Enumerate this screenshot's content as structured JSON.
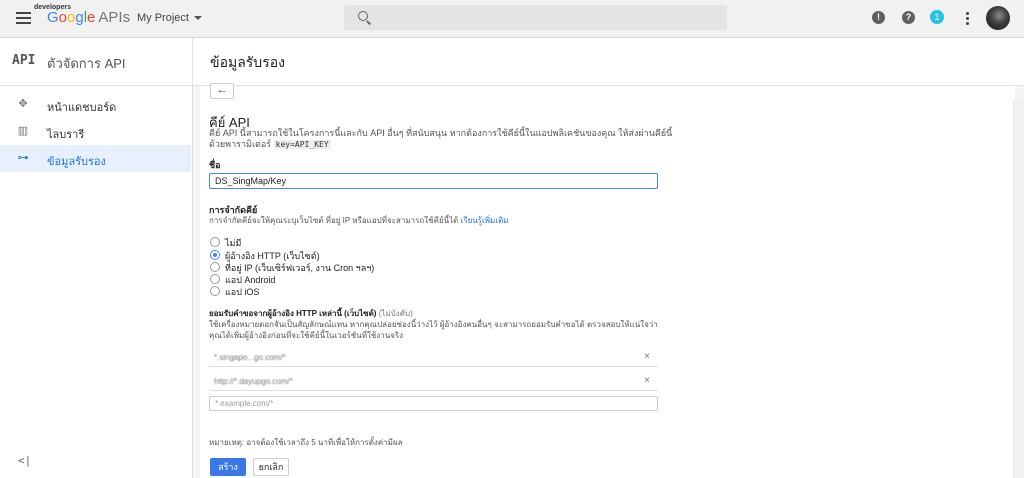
{
  "topbar": {
    "logo_small": "developers",
    "brand": {
      "g1": "G",
      "g2": "o",
      "g3": "o",
      "g4": "g",
      "g5": "l",
      "g6": "e",
      "apis": "APIs"
    },
    "project_name": "My Project",
    "notification_count": "1"
  },
  "sidebar": {
    "api_badge": "API",
    "title": "ตัวจัดการ API",
    "items": [
      {
        "label": "หน้าแดชบอร์ด",
        "icon": "dashboard-icon"
      },
      {
        "label": "ไลบรารี",
        "icon": "library-icon"
      },
      {
        "label": "ข้อมูลรับรอง",
        "icon": "key-icon"
      }
    ],
    "collapse": "<|"
  },
  "main": {
    "page_title": "ข้อมูลรับรอง",
    "back_label": "←",
    "section_title": "คีย์ API",
    "description_1": "คีย์ API นี้สามารถใช้ในโครงการนี้และกับ API อื่นๆ ที่สนับสนุน หากต้องการใช้คีย์นี้ในแอปพลิเคชันของคุณ ให้ส่งผ่านคีย์นี้",
    "description_2": "ด้วยพารามิเตอร์",
    "description_code": "key=API_KEY",
    "name_label": "ชื่อ",
    "name_value": "DS_SingMap/Key",
    "restriction_label": "การจำกัดคีย์",
    "restriction_desc": "การจำกัดคีย์จะให้คุณระบุเว็บไซต์ ที่อยู่ IP หรือแอปที่จะสามารถใช้คีย์นี้ได้",
    "restriction_link": "เรียนรู้เพิ่มเติม",
    "radios": [
      {
        "label": "ไม่มี",
        "checked": false
      },
      {
        "label": "ผู้อ้างอิง HTTP (เว็บไซต์)",
        "checked": true
      },
      {
        "label": "ที่อยู่ IP (เว็บเซิร์ฟเวอร์, งาน Cron ฯลฯ)",
        "checked": false
      },
      {
        "label": "แอป Android",
        "checked": false
      },
      {
        "label": "แอป iOS",
        "checked": false
      }
    ],
    "referrer_label": "ยอมรับคำขอจากผู้อ้างอิง HTTP เหล่านี้ (เว็บไซต์)",
    "referrer_optional": "(ไม่บังคับ)",
    "referrer_desc": "ใช้เครื่องหมายดอกจันเป็นสัญลักษณ์แทน หากคุณปล่อยช่องนี้ว่างไว้ ผู้อ้างอิงคนอื่นๆ จะสามารถยอมรับคำขอได้ ตรวจสอบให้แน่ใจว่าคุณได้เพิ่มผู้อ้างอิงก่อนที่จะใช้คีย์นี้ในเวอร์ชันที่ใช้งานจริง",
    "referrers": [
      {
        "value": "*.singapo...go.com/*"
      },
      {
        "value": "http://*.dayupgo.com/*"
      }
    ],
    "referrer_placeholder": "*.example.com/*",
    "note": "หมายเหตุ: อาจต้องใช้เวลาถึง 5 นาทีเพื่อให้การตั้งค่ามีผล",
    "create_label": "สร้าง",
    "cancel_label": "ยกเลิก"
  }
}
